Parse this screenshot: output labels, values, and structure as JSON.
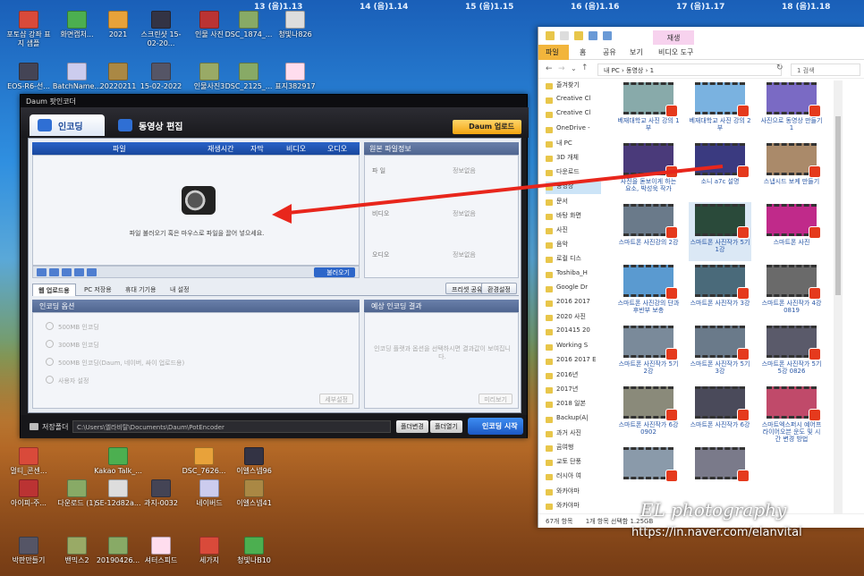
{
  "calendar": [
    {
      "d": "13",
      "lbl": "(음)1.13"
    },
    {
      "d": "14",
      "lbl": "(음)1.14"
    },
    {
      "d": "15",
      "lbl": "(음)1.15"
    },
    {
      "d": "16",
      "lbl": "(음)1.16"
    },
    {
      "d": "17",
      "lbl": "(음)1.17"
    },
    {
      "d": "18",
      "lbl": "(음)1.18"
    }
  ],
  "desktop_icons": [
    "포토샵 강좌 표지 샘플",
    "화면캡처...",
    "2021",
    "스크린샷 15-02-20...",
    "인물 사진",
    "DSC_1874_...",
    "청빛나826",
    "EOS-R6-선...",
    "BatchName...",
    "20220211",
    "15-02-2022",
    "인물사진3",
    "DSC_2125_...",
    "표지382917",
    "멀티_콘센...",
    "Kakao Talk_...",
    "DSC_7626...",
    "이엘스넴96",
    "아이피-주...",
    "다운로드 (1)",
    "SE-12d82a...",
    "과지-0032",
    "네이버드",
    "이엘스넴41",
    "박판만들기",
    "밴믹스2",
    "20190426...",
    "셔터스피드",
    "세가지",
    "청빛나B10"
  ],
  "pot": {
    "title": "Daum 팟인코더",
    "tab_encode": "인코딩",
    "tab_edit": "동영상 편집",
    "daum_upload": "Daum 업로드",
    "cols": {
      "file": "파일",
      "time": "재생시간",
      "sub": "자막",
      "video": "비디오",
      "audio": "오디오"
    },
    "drop_msg": "파일 불러오기 혹은 마우스로 파일을 끌어 넣으세요.",
    "load_btn": "불러오기",
    "orig_hdr": "원본 파일정보",
    "orig_rows": [
      {
        "k": "파 일",
        "v": "정보없음"
      },
      {
        "k": "비디오",
        "v": "정보없음"
      },
      {
        "k": "오디오",
        "v": "정보없음"
      }
    ],
    "opt_tabs": [
      "웹 업로드용",
      "PC 저장용",
      "휴대 기기용",
      "내 설정"
    ],
    "preset_btn": "프리셋 공유",
    "env_btn": "환경설정",
    "opt_hdr": "인코딩 옵션",
    "opt_items": [
      "500MB 인코딩",
      "300MB 인코딩",
      "500MB 인코딩(Daum, 네이버, 싸이 업로드용)",
      "사용자 설정"
    ],
    "detail_btn": "세부설정",
    "result_hdr": "예상 인코딩 결과",
    "result_msg": "인코딩 플랫과 옵션을 선택하시면 결과값이 보여집니다.",
    "preview_btn": "미리보기",
    "save_label": "저장폴더",
    "save_path": "C:\\Users\\엘라비탈\\Documents\\Daum\\PotEncoder",
    "change_btn": "폴더변경",
    "open_btn": "폴더열기",
    "start_btn": "인코딩 시작"
  },
  "explorer": {
    "context_tab": "재생",
    "ribbon": [
      "파일",
      "홈",
      "공유",
      "보기",
      "비디오 도구"
    ],
    "path": "내 PC  ›  동영상  ›  1",
    "search": "1 검색",
    "nav": [
      "즐겨찾기",
      "Creative Cl",
      "Creative Cl",
      "OneDrive -",
      "내 PC",
      "3D 개체",
      "다운로드",
      "동영상",
      "문서",
      "바탕 화면",
      "사진",
      "음악",
      "로컬 디스",
      "Toshiba_H",
      "Google Dr",
      "2016 2017",
      "2020 사진",
      "201415 20",
      "Working S",
      "2016 2017 E",
      "2016년",
      "2017년",
      "2018 일본",
      "Backup(A|",
      "과거 사진",
      "곰여행",
      "교토 단풍",
      "러시아 여",
      "와카야마",
      "와카야마"
    ],
    "files": [
      "베재대학교 사진 강의 1부",
      "베재대학교 사진 강의 2부",
      "사진으로 동영상 만들기 1",
      "사진을 돋보이게 하는 요소, 박성욱 작가",
      "소니 a7c 설명",
      "스냅시드 보케 만들기",
      "스마트폰 사진강의 2강",
      "스마트폰 사진작가 5기 1강",
      "스마트폰 사진",
      "스마트폰 사진강의 단과 후반부 보충",
      "스마트폰 사진작가 3강",
      "스마트폰 사진작가 4강 0819",
      "스마트폰 사진작가 5기 2강",
      "스마트폰 사진작가 5기 3강",
      "스마트폰 사진작가 5기 5강 0826",
      "스마트폰 사진작가 6강 0902",
      "스마트폰 사진작가 6강",
      "스마트엑스퍼시 예어프라이어오븐 운도 및 시간 변경 방법",
      "",
      ""
    ],
    "status_count": "67개 항목",
    "status_sel": "1개 항목 선택함 1.25GB"
  },
  "watermark": {
    "line1": "EL photography",
    "line2": "https://in.naver.com/elanvital"
  },
  "colors": {
    "accent": "#2d66c9",
    "arrow": "#e8261c"
  }
}
